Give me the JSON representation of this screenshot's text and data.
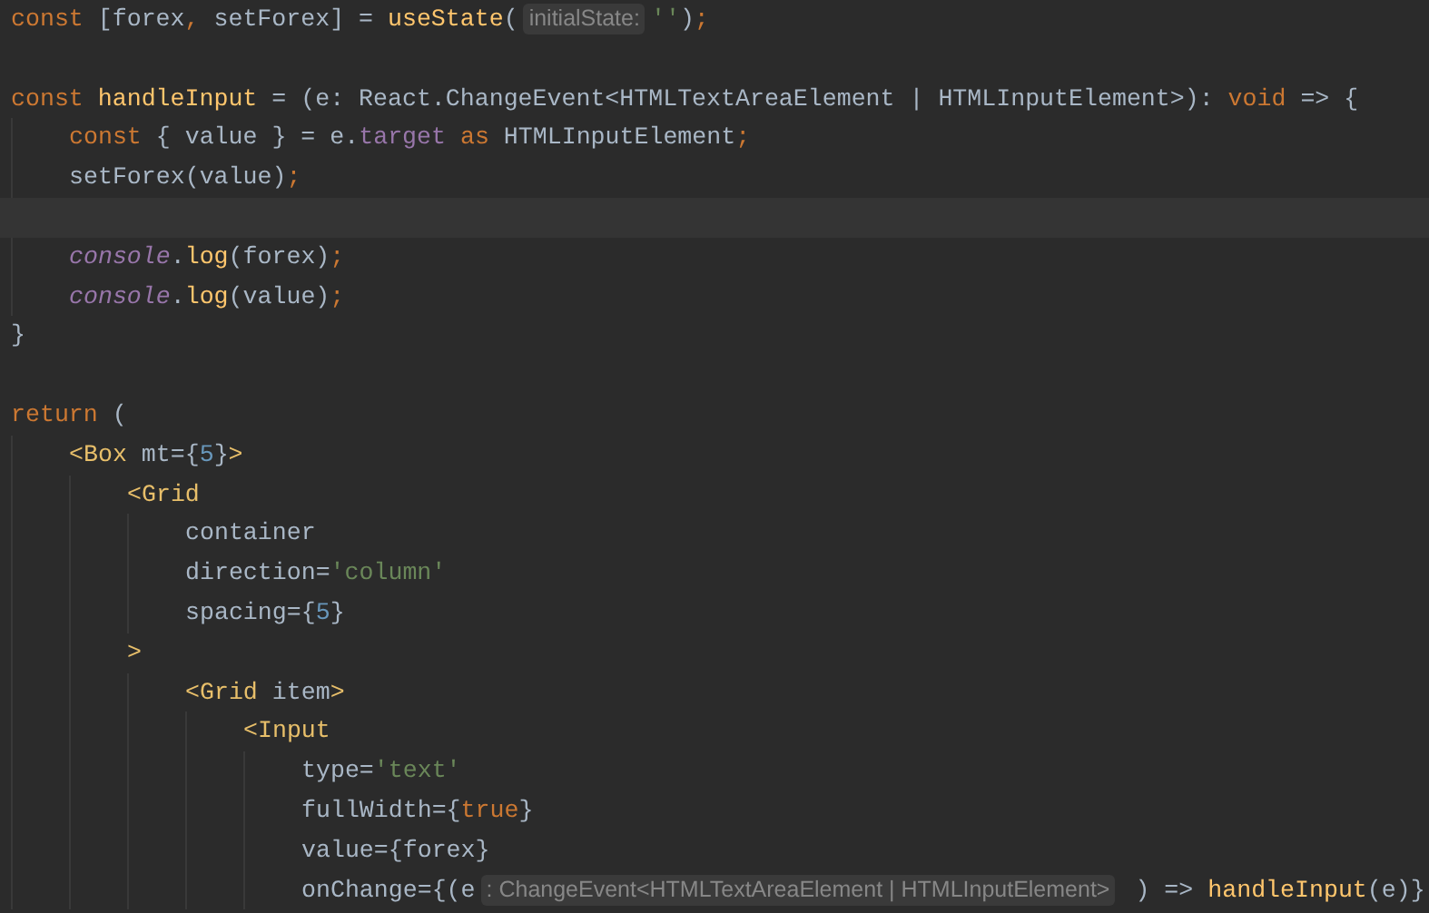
{
  "editor": {
    "lines": [
      {
        "kind": "code",
        "tokens": [
          {
            "kind": "keyword",
            "text": "const"
          },
          {
            "kind": "plain",
            "text": " [forex"
          },
          {
            "kind": "punct",
            "text": ","
          },
          {
            "kind": "plain",
            "text": " setForex] = "
          },
          {
            "kind": "function",
            "text": "useState"
          },
          {
            "kind": "plain",
            "text": "("
          },
          {
            "kind": "hint",
            "text": "initialState:"
          },
          {
            "kind": "string",
            "text": "''"
          },
          {
            "kind": "plain",
            "text": ")"
          },
          {
            "kind": "punct",
            "text": ";"
          }
        ]
      },
      {
        "kind": "blank"
      },
      {
        "kind": "code",
        "tokens": [
          {
            "kind": "keyword",
            "text": "const "
          },
          {
            "kind": "function",
            "text": "handleInput"
          },
          {
            "kind": "plain",
            "text": " = (e: React.ChangeEvent<HTMLTextAreaElement | HTMLInputElement>): "
          },
          {
            "kind": "keyword",
            "text": "void"
          },
          {
            "kind": "plain",
            "text": " => {"
          }
        ]
      },
      {
        "kind": "code",
        "tokens": [
          {
            "kind": "keyword",
            "text": "    const"
          },
          {
            "kind": "plain",
            "text": " { value } = e."
          },
          {
            "kind": "field",
            "text": "target"
          },
          {
            "kind": "keyword",
            "text": " as"
          },
          {
            "kind": "plain",
            "text": " HTMLInputElement"
          },
          {
            "kind": "punct",
            "text": ";"
          }
        ]
      },
      {
        "kind": "code",
        "tokens": [
          {
            "kind": "plain",
            "text": "    setForex(value)"
          },
          {
            "kind": "punct",
            "text": ";"
          }
        ]
      },
      {
        "kind": "blank",
        "current": true
      },
      {
        "kind": "code",
        "tokens": [
          {
            "kind": "global",
            "text": "    console"
          },
          {
            "kind": "plain",
            "text": "."
          },
          {
            "kind": "function",
            "text": "log"
          },
          {
            "kind": "plain",
            "text": "(forex)"
          },
          {
            "kind": "punct",
            "text": ";"
          }
        ]
      },
      {
        "kind": "code",
        "tokens": [
          {
            "kind": "global",
            "text": "    console"
          },
          {
            "kind": "plain",
            "text": "."
          },
          {
            "kind": "function",
            "text": "log"
          },
          {
            "kind": "plain",
            "text": "(value)"
          },
          {
            "kind": "punct",
            "text": ";"
          }
        ]
      },
      {
        "kind": "code",
        "tokens": [
          {
            "kind": "plain",
            "text": "}"
          }
        ]
      },
      {
        "kind": "blank"
      },
      {
        "kind": "code",
        "tokens": [
          {
            "kind": "keyword",
            "text": "return"
          },
          {
            "kind": "plain",
            "text": " ("
          }
        ]
      },
      {
        "kind": "code",
        "tokens": [
          {
            "kind": "tag",
            "text": "    <Box"
          },
          {
            "kind": "plain",
            "text": " mt={"
          },
          {
            "kind": "number",
            "text": "5"
          },
          {
            "kind": "plain",
            "text": "}"
          },
          {
            "kind": "tag",
            "text": ">"
          }
        ]
      },
      {
        "kind": "code",
        "tokens": [
          {
            "kind": "tag",
            "text": "        <Grid"
          }
        ]
      },
      {
        "kind": "code",
        "tokens": [
          {
            "kind": "plain",
            "text": "            container"
          }
        ]
      },
      {
        "kind": "code",
        "tokens": [
          {
            "kind": "plain",
            "text": "            direction="
          },
          {
            "kind": "string",
            "text": "'column'"
          }
        ]
      },
      {
        "kind": "code",
        "tokens": [
          {
            "kind": "plain",
            "text": "            spacing={"
          },
          {
            "kind": "number",
            "text": "5"
          },
          {
            "kind": "plain",
            "text": "}"
          }
        ]
      },
      {
        "kind": "code",
        "tokens": [
          {
            "kind": "tag",
            "text": "        >"
          }
        ]
      },
      {
        "kind": "code",
        "tokens": [
          {
            "kind": "tag",
            "text": "            <Grid"
          },
          {
            "kind": "plain",
            "text": " item"
          },
          {
            "kind": "tag",
            "text": ">"
          }
        ]
      },
      {
        "kind": "code",
        "tokens": [
          {
            "kind": "tag",
            "text": "                <Input"
          }
        ]
      },
      {
        "kind": "code",
        "tokens": [
          {
            "kind": "plain",
            "text": "                    type="
          },
          {
            "kind": "string",
            "text": "'text'"
          }
        ]
      },
      {
        "kind": "code",
        "tokens": [
          {
            "kind": "plain",
            "text": "                    fullWidth={"
          },
          {
            "kind": "keyword",
            "text": "true"
          },
          {
            "kind": "plain",
            "text": "}"
          }
        ]
      },
      {
        "kind": "code",
        "tokens": [
          {
            "kind": "plain",
            "text": "                    value={forex}"
          }
        ]
      },
      {
        "kind": "code",
        "tokens": [
          {
            "kind": "plain",
            "text": "                    onChange={(e"
          },
          {
            "kind": "hint",
            "text": ": ChangeEvent<HTMLTextAreaElement | HTMLInputElement>"
          },
          {
            "kind": "plain",
            "text": " ) => "
          },
          {
            "kind": "function",
            "text": "handleInput"
          },
          {
            "kind": "plain",
            "text": "(e)}"
          }
        ]
      }
    ]
  }
}
